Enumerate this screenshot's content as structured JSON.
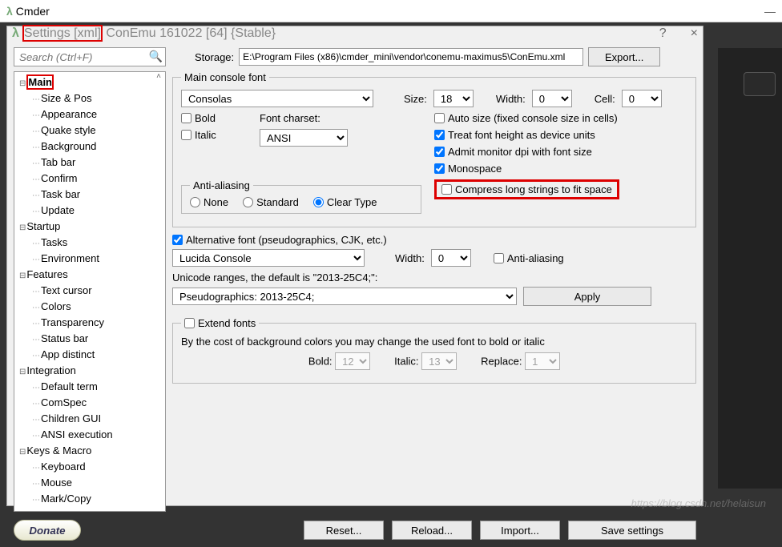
{
  "outer": {
    "title": "Cmder"
  },
  "dialog": {
    "title1": "Settings [xml]",
    "title2": " ConEmu 161022 [64] {Stable}",
    "help": "?",
    "close": "×"
  },
  "search": {
    "placeholder": "Search (Ctrl+F)"
  },
  "storage": {
    "label": "Storage:",
    "value": "E:\\Program Files (x86)\\cmder_mini\\vendor\\conemu-maximus5\\ConEmu.xml",
    "export": "Export..."
  },
  "tree": {
    "n0": "Main",
    "n0_0": "Size & Pos",
    "n0_1": "Appearance",
    "n0_2": "Quake style",
    "n0_3": "Background",
    "n0_4": "Tab bar",
    "n0_5": "Confirm",
    "n0_6": "Task bar",
    "n0_7": "Update",
    "n1": "Startup",
    "n1_0": "Tasks",
    "n1_1": "Environment",
    "n2": "Features",
    "n2_0": "Text cursor",
    "n2_1": "Colors",
    "n2_2": "Transparency",
    "n2_3": "Status bar",
    "n2_4": "App distinct",
    "n3": "Integration",
    "n3_0": "Default term",
    "n3_1": "ComSpec",
    "n3_2": "Children GUI",
    "n3_3": "ANSI execution",
    "n4": "Keys & Macro",
    "n4_0": "Keyboard",
    "n4_1": "Mouse",
    "n4_2": "Mark/Copy"
  },
  "font": {
    "legend": "Main console font",
    "family": "Consolas",
    "sizeLabel": "Size:",
    "sizeVal": "18",
    "widthLabel": "Width:",
    "widthVal": "0",
    "cellLabel": "Cell:",
    "cellVal": "0",
    "bold": "Bold",
    "italic": "Italic",
    "charsetLabel": "Font charset:",
    "charsetVal": "ANSI",
    "aaLegend": "Anti-aliasing",
    "aaNone": "None",
    "aaStd": "Standard",
    "aaClear": "Clear Type",
    "autosize": "Auto size (fixed console size in cells)",
    "treat": "Treat font height as device units",
    "admit": "Admit monitor dpi with font size",
    "mono": "Monospace",
    "compress": "Compress long strings to fit space"
  },
  "alt": {
    "cb": "Alternative font (pseudographics, CJK, etc.)",
    "family": "Lucida Console",
    "widthLabel": "Width:",
    "widthVal": "0",
    "aa": "Anti-aliasing",
    "rangeLabel": "Unicode ranges, the default is \"2013-25C4;\":",
    "rangeVal": "Pseudographics: 2013-25C4;",
    "apply": "Apply"
  },
  "ext": {
    "legend": "Extend fonts",
    "desc": "By the cost of background colors you may change the used font to bold or italic",
    "boldLabel": "Bold:",
    "boldVal": "12",
    "italicLabel": "Italic:",
    "italicVal": "13",
    "replaceLabel": "Replace:",
    "replaceVal": "1"
  },
  "footer": {
    "donate": "Donate",
    "reset": "Reset...",
    "reload": "Reload...",
    "import": "Import...",
    "save": "Save settings"
  }
}
